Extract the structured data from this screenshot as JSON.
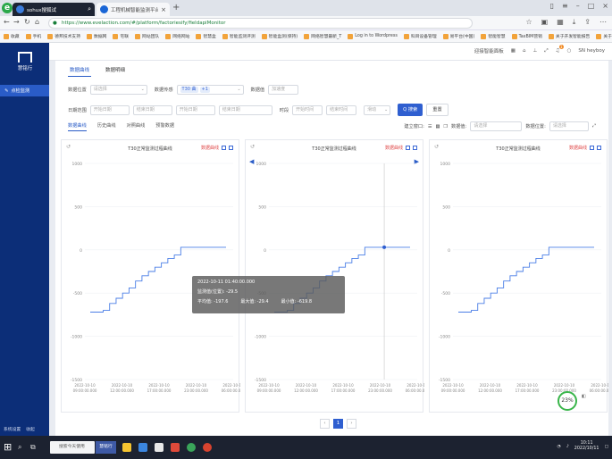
{
  "browser": {
    "logo": "e",
    "search_tab": "sohux搜狐试",
    "page_tab": "工程机械智能监测平台",
    "url": "https://www.evelaction.com/#/platform/factoriesify/fieldapiMonitor",
    "bookmarks": [
      "收藏",
      "手机",
      "德邦技术支持",
      "数据网",
      "宅联",
      "网站团队",
      "网络网站",
      "智慧盒",
      "智能监测评测",
      "智能盒测(保持)",
      "网络智慧最新_T",
      "Log in to Wordpress",
      "科目设备管理",
      "易平台(中国)",
      "智能智慧",
      "TaxBIM营销",
      "关于开发智能报告",
      "关于运营报告"
    ]
  },
  "app": {
    "brand_name": "慧铭行",
    "sidebar_item": "点检监测",
    "sidebar_bottom": [
      "系统设置",
      "收起"
    ],
    "header_user": "迎接智能面板",
    "header_account": "SN heyboy",
    "notification_count": "1"
  },
  "tabs": [
    "数据曲线",
    "数据明细"
  ],
  "filters": {
    "row1": {
      "label_a": "数据位置",
      "placeholder_a": "请选择",
      "label_b": "数据传感",
      "chip_1": "T30 曲",
      "chip_2": "+1",
      "label_c": "数据值",
      "value_c": "加速度"
    },
    "row2": {
      "label_a": "日期范围",
      "start_placeholder": "开始日期",
      "end_placeholder": "结束日期",
      "label_b": "时段",
      "time_from": "开始时间",
      "time_to": "结束时间",
      "interval": "滑动"
    },
    "search_label": "Q 搜索",
    "reset_label": "重置"
  },
  "sub_tabs": [
    "数据曲线",
    "历史曲线",
    "对照曲线",
    "预警数据"
  ],
  "sub_right": {
    "label": "建立窗口:",
    "label2": "数据值:",
    "placeholder": "请选择",
    "label3": "数据位置:",
    "placeholder2": "请选择"
  },
  "panels": [
    {
      "title": "T30正常监测过程曲线",
      "tool_label": "数据曲线"
    },
    {
      "title": "T30正常监测过程曲线",
      "tool_label": "数据曲线"
    },
    {
      "title": "T30正常监测过程曲线",
      "tool_label": "数据曲线"
    }
  ],
  "chart_data": [
    {
      "type": "line",
      "title": "T30正常监测过程曲线",
      "y_ticks": [
        "1000",
        "500",
        "0",
        "-500",
        "-1000",
        "-1500"
      ],
      "ylim": [
        -1500,
        1000
      ],
      "x_ticks": [
        "2022-10-10\n09:00:00.000",
        "2022-10-10\n12:00:00.000",
        "2022-10-10\n17:00:00.000",
        "2022-10-10\n23:00:00.000",
        "2022-10-11\n06:00:00.000"
      ],
      "series": [
        {
          "values": [
            -720,
            -720,
            -700,
            -620,
            -560,
            -500,
            -440,
            -360,
            -300,
            -250,
            -200,
            -150,
            -100,
            -60,
            30,
            30,
            30,
            30,
            30,
            30,
            30,
            30
          ]
        }
      ],
      "grid": true
    },
    {
      "type": "line",
      "title": "T30正常监测过程曲线",
      "y_ticks": [
        "1000",
        "500",
        "0",
        "-500",
        "-1000",
        "-1500"
      ],
      "ylim": [
        -1500,
        1000
      ],
      "x_ticks": [
        "2022-10-10\n09:00:00.000",
        "2022-10-10\n12:00:00.000",
        "2022-10-10\n17:00:00.000",
        "2022-10-10\n23:00:00.000",
        "2022-10-11\n06:00:00.000"
      ],
      "series": [
        {
          "values": [
            -720,
            -720,
            -700,
            -620,
            -560,
            -500,
            -440,
            -360,
            -300,
            -250,
            -200,
            -150,
            -100,
            -60,
            30,
            30,
            30,
            30,
            30,
            30,
            30,
            30
          ]
        }
      ],
      "grid": true
    },
    {
      "type": "line",
      "title": "T30正常监测过程曲线",
      "y_ticks": [
        "1000",
        "500",
        "0",
        "-500",
        "-1000",
        "-1500"
      ],
      "ylim": [
        -1500,
        1000
      ],
      "x_ticks": [
        "2022-10-10\n09:00:00.000",
        "2022-10-10\n12:00:00.000",
        "2022-10-10\n17:00:00.000",
        "2022-10-10\n23:00:00.000",
        "2022-10-11\n06:00:00.000"
      ],
      "series": [
        {
          "values": [
            -720,
            -720,
            -700,
            -620,
            -560,
            -500,
            -440,
            -360,
            -300,
            -250,
            -200,
            -150,
            -100,
            -60,
            30,
            30,
            30,
            30,
            30,
            30,
            30,
            30
          ]
        }
      ],
      "grid": true
    }
  ],
  "tooltip": {
    "time": "2022-10-11 01:40:00.000",
    "current": "监测值(位置): -29.5",
    "avg": "平均值: -197.6",
    "max": "最大值: -29.4",
    "min": "最小值: -619.8"
  },
  "pager": {
    "prev": "‹",
    "current": "1",
    "next": "›"
  },
  "gauge": "23%",
  "taskbar": {
    "search": "搜索今天使用",
    "active_app": "慧铭行",
    "time": "10:11",
    "date": "2022/10/11"
  },
  "colors": {
    "accent": "#2f5fd0",
    "line": "#4a7ee6",
    "sidebar": "#0c2e78"
  }
}
